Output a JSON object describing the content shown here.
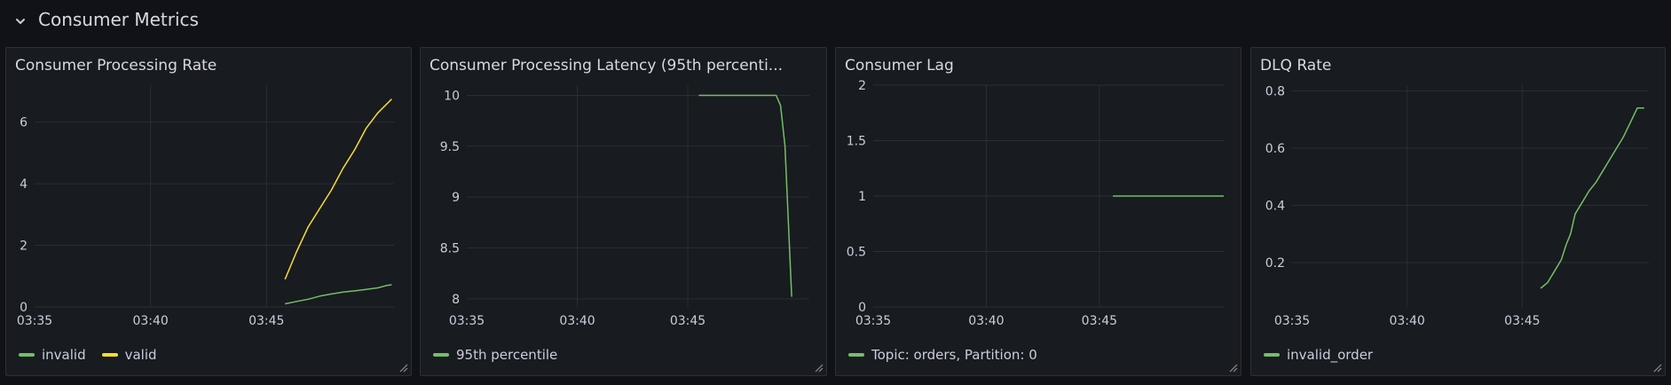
{
  "row": {
    "title": "Consumer Metrics",
    "collapse_icon": "chevron-down-icon"
  },
  "colors": {
    "background": "#111217",
    "panel_bg": "#181b1f",
    "grid": "#2a2d32",
    "axis_text": "#ccccdc",
    "green": "#73bf69",
    "yellow": "#fade2a"
  },
  "panels": [
    {
      "title": "Consumer Processing Rate",
      "legend": [
        {
          "label": "invalid",
          "color": "#73bf69"
        },
        {
          "label": "valid",
          "color": "#fade2a"
        }
      ]
    },
    {
      "title": "Consumer Processing Latency (95th percenti...",
      "legend": [
        {
          "label": "95th percentile",
          "color": "#73bf69"
        }
      ]
    },
    {
      "title": "Consumer Lag",
      "legend": [
        {
          "label": "Topic: orders, Partition: 0",
          "color": "#73bf69"
        }
      ]
    },
    {
      "title": "DLQ Rate",
      "legend": [
        {
          "label": "invalid_order",
          "color": "#73bf69"
        }
      ]
    }
  ],
  "chart_data": [
    {
      "type": "line",
      "title": "Consumer Processing Rate",
      "x_ticks": [
        "03:35",
        "03:40",
        "03:45"
      ],
      "y_ticks": [
        "0",
        "2",
        "4",
        "6"
      ],
      "ylim": [
        0,
        7.2
      ],
      "xlim_minutes": [
        35,
        50.5
      ],
      "grid": true,
      "legend_placement": "bottom-left",
      "series": [
        {
          "name": "invalid",
          "color": "#73bf69",
          "x": [
            45.8,
            46.3,
            46.8,
            47.3,
            47.8,
            48.3,
            48.8,
            49.3,
            49.8,
            50.2,
            50.4
          ],
          "y": [
            0.1,
            0.18,
            0.25,
            0.35,
            0.42,
            0.48,
            0.52,
            0.57,
            0.62,
            0.7,
            0.72
          ]
        },
        {
          "name": "valid",
          "color": "#fade2a",
          "x": [
            45.8,
            46.3,
            46.8,
            47.3,
            47.8,
            48.3,
            48.8,
            49.3,
            49.8,
            50.4
          ],
          "y": [
            0.9,
            1.8,
            2.6,
            3.2,
            3.8,
            4.5,
            5.1,
            5.8,
            6.3,
            6.75
          ]
        }
      ]
    },
    {
      "type": "line",
      "title": "Consumer Processing Latency (95th percenti...",
      "x_ticks": [
        "03:35",
        "03:40",
        "03:45"
      ],
      "y_ticks": [
        "8",
        "8.5",
        "9",
        "9.5",
        "10"
      ],
      "ylim": [
        7.92,
        10.1
      ],
      "xlim_minutes": [
        35,
        50.5
      ],
      "grid": true,
      "legend_placement": "bottom-left",
      "series": [
        {
          "name": "95th percentile",
          "color": "#73bf69",
          "x": [
            45.5,
            46.5,
            47.5,
            48.5,
            49.0,
            49.2,
            49.4,
            49.7
          ],
          "y": [
            10,
            10,
            10,
            10,
            10,
            9.9,
            9.5,
            8.02
          ]
        }
      ]
    },
    {
      "type": "line",
      "title": "Consumer Lag",
      "x_ticks": [
        "03:35",
        "03:40",
        "03:45"
      ],
      "y_ticks": [
        "0",
        "0.5",
        "1",
        "1.5",
        "2"
      ],
      "ylim": [
        0,
        2
      ],
      "xlim_minutes": [
        35,
        50.5
      ],
      "grid": true,
      "legend_placement": "bottom-left",
      "series": [
        {
          "name": "Topic: orders, Partition: 0",
          "color": "#73bf69",
          "x": [
            45.6,
            50.5
          ],
          "y": [
            1,
            1
          ]
        }
      ]
    },
    {
      "type": "line",
      "title": "DLQ Rate",
      "x_ticks": [
        "03:35",
        "03:40",
        "03:45"
      ],
      "y_ticks": [
        "0.2",
        "0.4",
        "0.6",
        "0.8"
      ],
      "ylim": [
        0.045,
        0.82
      ],
      "xlim_minutes": [
        35,
        50.5
      ],
      "grid": true,
      "legend_placement": "bottom-left",
      "series": [
        {
          "name": "invalid_order",
          "color": "#73bf69",
          "x": [
            45.8,
            46.1,
            46.4,
            46.7,
            46.9,
            47.1,
            47.3,
            47.6,
            47.9,
            48.2,
            48.5,
            48.8,
            49.1,
            49.4,
            49.7,
            50.0,
            50.3
          ],
          "y": [
            0.11,
            0.13,
            0.17,
            0.21,
            0.26,
            0.3,
            0.37,
            0.41,
            0.45,
            0.48,
            0.52,
            0.56,
            0.6,
            0.64,
            0.69,
            0.74,
            0.74
          ]
        }
      ]
    }
  ]
}
